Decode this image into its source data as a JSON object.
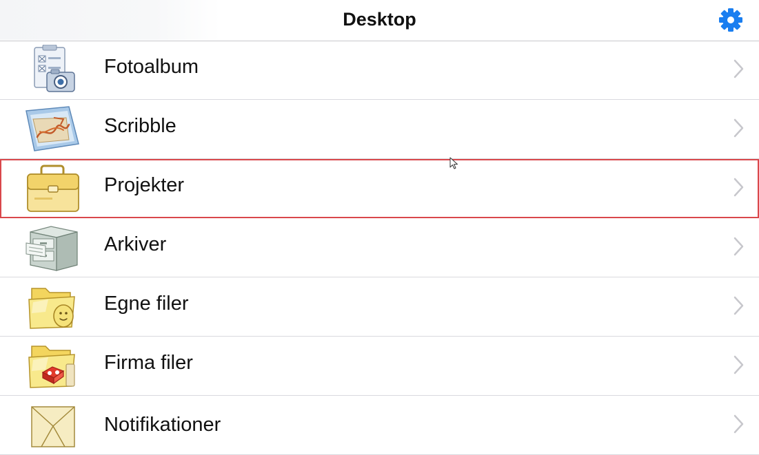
{
  "navbar": {
    "title": "Desktop",
    "settings_icon": "gear-icon",
    "accent_color": "#1a7ef0"
  },
  "list": {
    "items": [
      {
        "label": "Fotoalbum",
        "icon": "photo-album-icon"
      },
      {
        "label": "Scribble",
        "icon": "scribble-icon"
      },
      {
        "label": "Projekter",
        "icon": "briefcase-icon",
        "highlighted": true
      },
      {
        "label": "Arkiver",
        "icon": "archive-cabinet-icon"
      },
      {
        "label": "Egne filer",
        "icon": "personal-folder-icon"
      },
      {
        "label": "Firma filer",
        "icon": "company-folder-icon"
      },
      {
        "label": "Notifikationer",
        "icon": "notification-envelope-icon"
      }
    ],
    "chevron_icon": "chevron-right-icon"
  },
  "colors": {
    "highlight_border": "#d9474b",
    "separator": "#d9d9de"
  }
}
